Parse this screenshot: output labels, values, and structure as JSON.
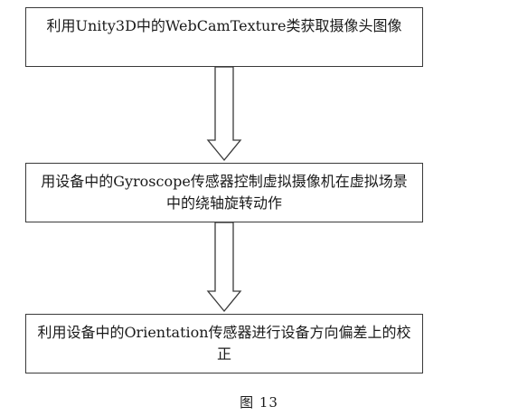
{
  "steps": [
    {
      "text": "利用Unity3D中的WebCamTexture类获取摄像头图像"
    },
    {
      "text": "用设备中的Gyroscope传感器控制虚拟摄像机在虚拟场景中的绕轴旋转动作"
    },
    {
      "text": "利用设备中的Orientation传感器进行设备方向偏差上的校正"
    }
  ],
  "caption": "图 13"
}
